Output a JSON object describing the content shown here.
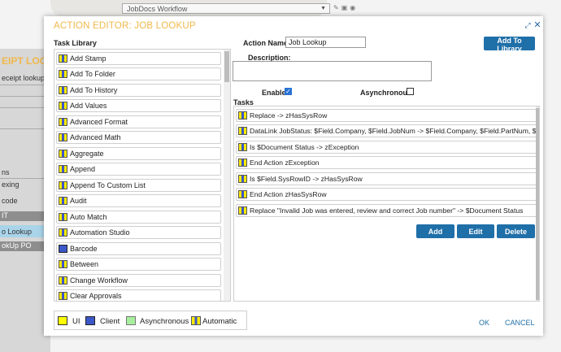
{
  "background": {
    "workflow_select": "JobDocs Workflow",
    "sidebar": {
      "header": "EIPT LOOKU",
      "items": [
        "eceipt lookup",
        "ns",
        "exing",
        "code",
        "IT",
        "o Lookup",
        "okUp PO"
      ]
    }
  },
  "dialog": {
    "title": "ACTION EDITOR: JOB LOOKUP",
    "task_library_label": "Task Library",
    "library_items": [
      {
        "label": "Add Stamp",
        "icon": "automatic"
      },
      {
        "label": "Add To Folder",
        "icon": "automatic"
      },
      {
        "label": "Add To History",
        "icon": "automatic"
      },
      {
        "label": "Add Values",
        "icon": "automatic"
      },
      {
        "label": "Advanced Format",
        "icon": "automatic"
      },
      {
        "label": "Advanced Math",
        "icon": "automatic"
      },
      {
        "label": "Aggregate",
        "icon": "automatic"
      },
      {
        "label": "Append",
        "icon": "automatic"
      },
      {
        "label": "Append To Custom List",
        "icon": "automatic"
      },
      {
        "label": "Audit",
        "icon": "automatic"
      },
      {
        "label": "Auto Match",
        "icon": "automatic"
      },
      {
        "label": "Automation Studio",
        "icon": "automatic"
      },
      {
        "label": "Barcode",
        "icon": "client"
      },
      {
        "label": "Between",
        "icon": "automatic"
      },
      {
        "label": "Change Workflow",
        "icon": "automatic"
      },
      {
        "label": "Clear Approvals",
        "icon": "automatic"
      }
    ],
    "action_name_label": "Action Name:",
    "action_name_value": "Job Lookup",
    "add_to_library_label": "Add To Library",
    "description_label": "Description:",
    "description_value": "",
    "enable_label": "Enable:",
    "enable_checked": true,
    "asynchronous_label": "Asynchronous:",
    "asynchronous_checked": false,
    "tasks_label": "Tasks",
    "tasks": [
      "Replace -> zHasSysRow",
      "DataLink JobStatus: $Field.Company, $Field.JobNum -> $Field.Company, $Field.PartNum, $Fi...",
      "Is $Document Status -> zException",
      "End Action zException",
      "Is $Field.SysRowID -> zHasSysRow",
      "End Action zHasSysRow",
      "Replace \"Invalid Job was entered, review and correct Job number\" -> $Document Status"
    ],
    "add_label": "Add",
    "edit_label": "Edit",
    "delete_label": "Delete",
    "legend": {
      "ui": "UI",
      "client": "Client",
      "asynchronous": "Asynchronous",
      "automatic": "Automatic"
    },
    "ok_label": "OK",
    "cancel_label": "CANCEL",
    "colors": {
      "accent": "#1f6fa8",
      "title": "#f0b84a",
      "ui": "#ffff00",
      "client": "#3b57c8",
      "asynchronous": "#a7ee9e"
    }
  }
}
